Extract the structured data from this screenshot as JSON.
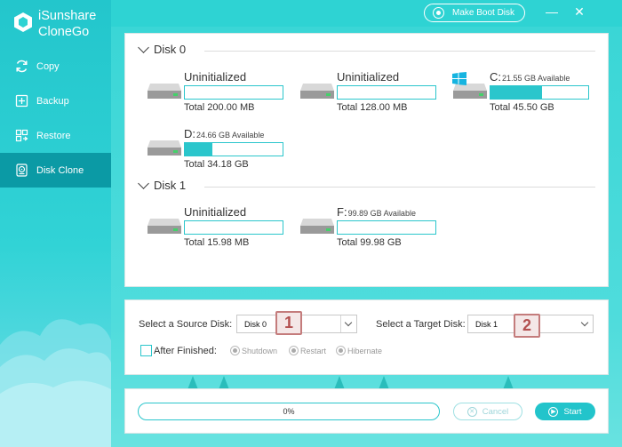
{
  "app": {
    "name_line1": "iSunshare",
    "name_line2": "CloneGo"
  },
  "nav": [
    {
      "label": "Copy",
      "icon": "copy-icon",
      "active": false
    },
    {
      "label": "Backup",
      "icon": "backup-icon",
      "active": false
    },
    {
      "label": "Restore",
      "icon": "restore-icon",
      "active": false
    },
    {
      "label": "Disk Clone",
      "icon": "disk-clone-icon",
      "active": true
    }
  ],
  "titlebar": {
    "make_boot_disk": "Make Boot Disk",
    "minimize": "—",
    "close": "✕"
  },
  "disks": [
    {
      "name": "Disk 0",
      "partitions": [
        {
          "label": "Uninitialized",
          "available": "",
          "total": "Total 200.00 MB",
          "used_fraction": 0,
          "windows": false
        },
        {
          "label": "Uninitialized",
          "available": "",
          "total": "Total 128.00 MB",
          "used_fraction": 0,
          "windows": false
        },
        {
          "label": "C:",
          "available": "21.55 GB Available",
          "total": "Total 45.50 GB",
          "used_fraction": 0.53,
          "windows": true
        },
        {
          "label": "D:",
          "available": "24.66 GB Available",
          "total": "Total 34.18 GB",
          "used_fraction": 0.28,
          "windows": false
        }
      ]
    },
    {
      "name": "Disk 1",
      "partitions": [
        {
          "label": "Uninitialized",
          "available": "",
          "total": "Total 15.98 MB",
          "used_fraction": 0,
          "windows": false
        },
        {
          "label": "F:",
          "available": "99.89 GB Available",
          "total": "Total 99.98 GB",
          "used_fraction": 0,
          "windows": false
        }
      ]
    }
  ],
  "options": {
    "source_label": "Select a Source Disk:",
    "source_value": "Disk 0",
    "target_label": "Select a Target Disk:",
    "target_value": "Disk 1",
    "badge_1": "1",
    "badge_2": "2",
    "after_finished": "After Finished:",
    "radios": [
      "Shutdown",
      "Restart",
      "Hibernate"
    ]
  },
  "progress": {
    "text": "0%",
    "value": 0
  },
  "buttons": {
    "cancel": "Cancel",
    "start": "Start"
  },
  "colors": {
    "accent": "#2bc6cc",
    "sidebar_active": "#0b9aa5",
    "badge_border": "#c47c7c"
  }
}
